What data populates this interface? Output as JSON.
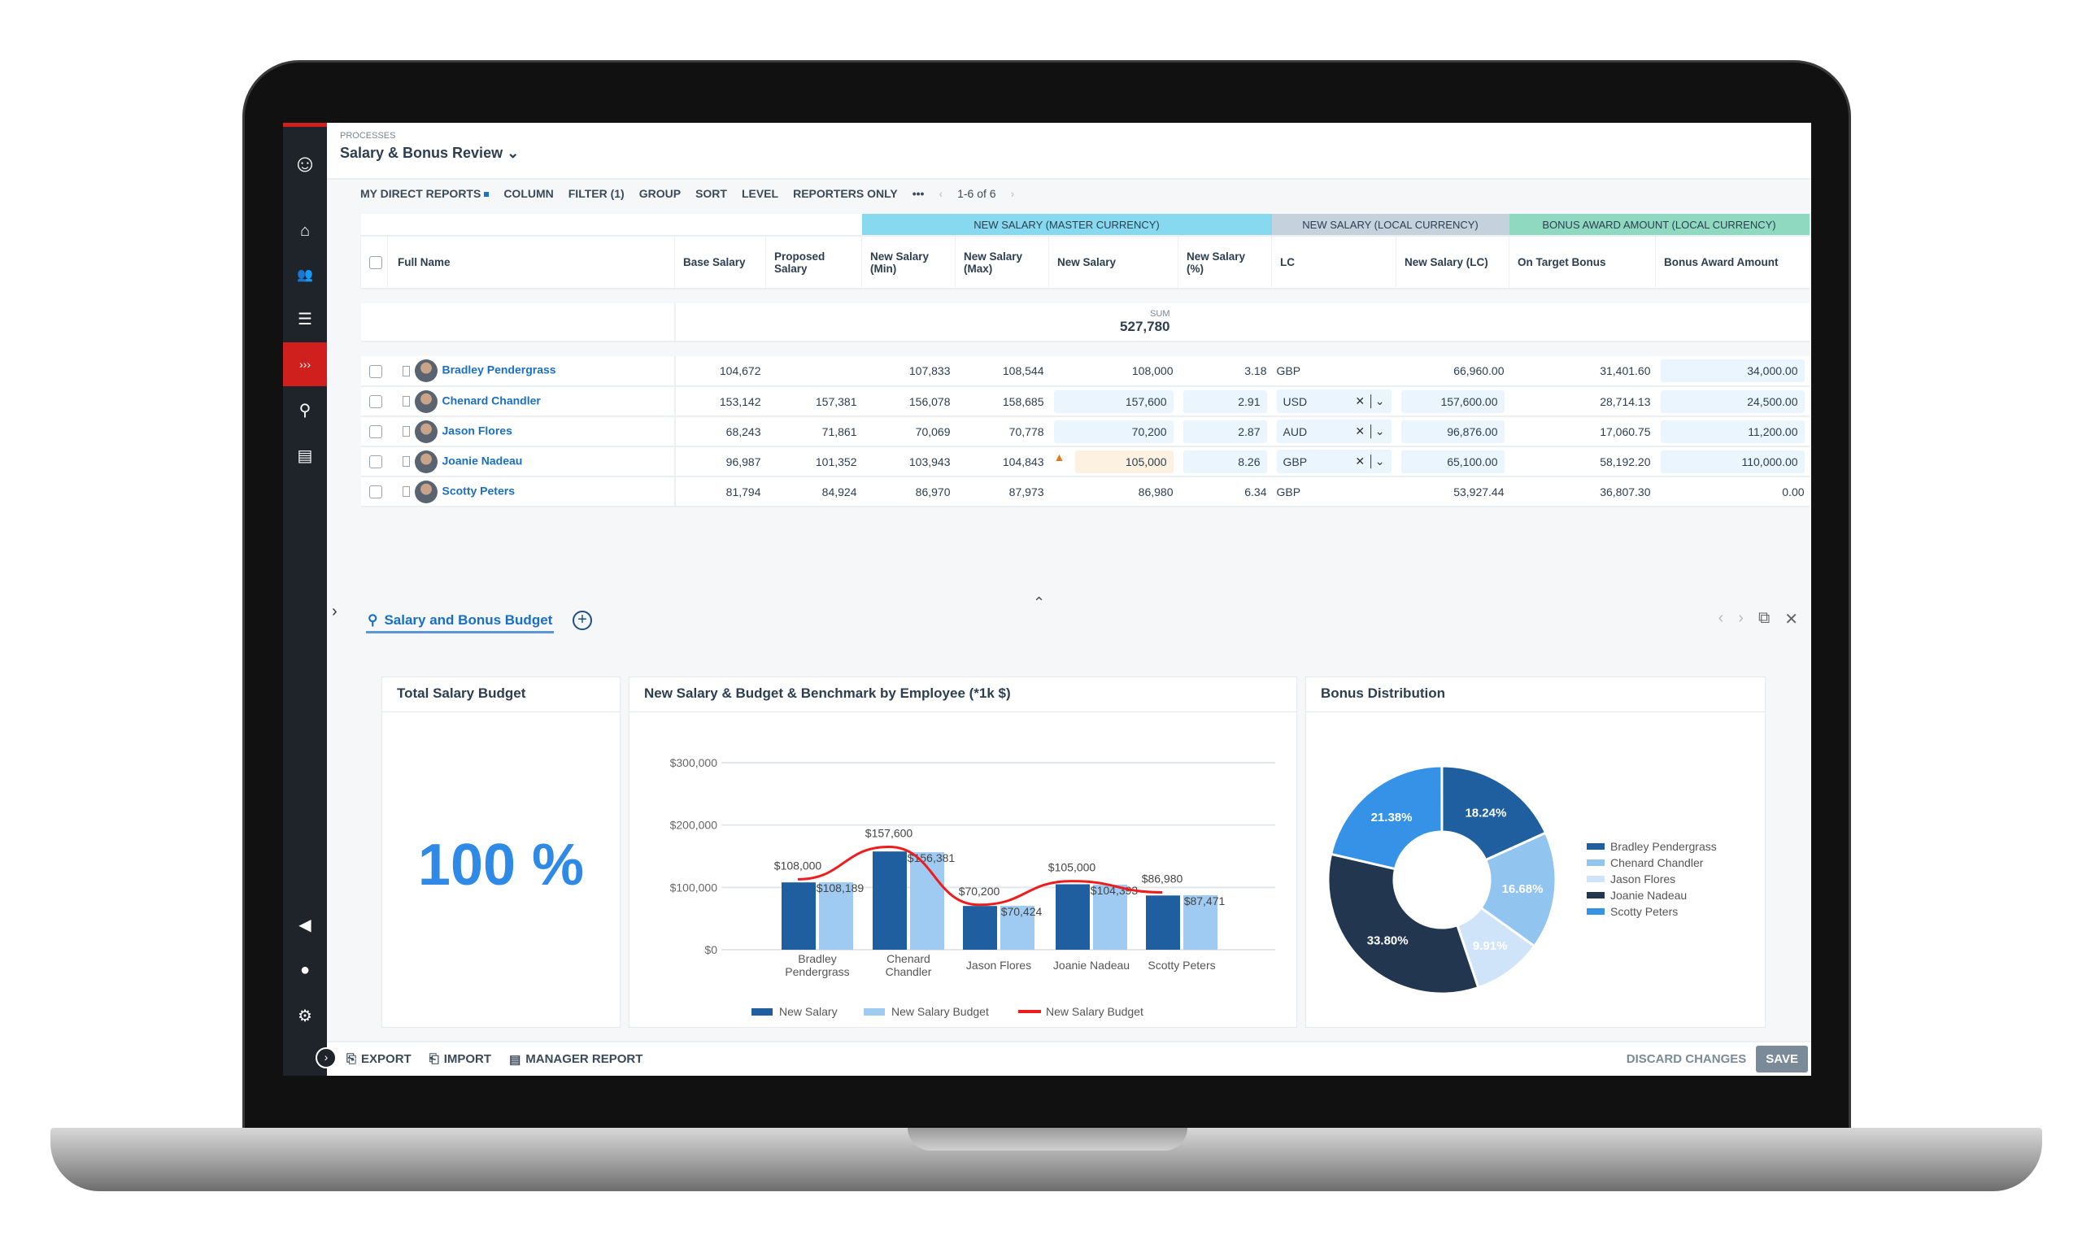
{
  "header": {
    "breadcrumb": "PROCESSES",
    "title": "Salary & Bonus Review"
  },
  "toolbar": {
    "items": [
      "MY DIRECT REPORTS",
      "COLUMN",
      "FILTER (1)",
      "GROUP",
      "SORT",
      "LEVEL",
      "REPORTERS ONLY"
    ],
    "more": "•••",
    "pagination": "1-6 of 6"
  },
  "table": {
    "groups": [
      {
        "label": "NEW SALARY (MASTER CURRENCY)",
        "color": "#86d9ef"
      },
      {
        "label": "NEW SALARY (LOCAL CURRENCY)",
        "color": "#c5d1dc"
      },
      {
        "label": "BONUS AWARD AMOUNT (LOCAL CURRENCY)",
        "color": "#8ed9c0"
      }
    ],
    "columns": [
      "Full Name",
      "Base Salary",
      "Proposed Salary",
      "New Salary (Min)",
      "New Salary (Max)",
      "New Salary",
      "New Salary (%)",
      "LC",
      "New Salary (LC)",
      "On Target Bonus",
      "Bonus Award Amount"
    ],
    "sum_label": "SUM",
    "sum_value": "527,780",
    "rows": [
      {
        "name": "Bradley Pendergrass",
        "base": "104,672",
        "proposed": "",
        "min": "107,833",
        "max": "108,544",
        "new": "108,000",
        "pct": "3.18",
        "lc": "GBP",
        "new_lc": "66,960.00",
        "target": "31,401.60",
        "bonus": "34,000.00",
        "editable": false,
        "warning": false
      },
      {
        "name": "Chenard Chandler",
        "base": "153,142",
        "proposed": "157,381",
        "min": "156,078",
        "max": "158,685",
        "new": "157,600",
        "pct": "2.91",
        "lc": "USD",
        "new_lc": "157,600.00",
        "target": "28,714.13",
        "bonus": "24,500.00",
        "editable": true,
        "warning": false
      },
      {
        "name": "Jason Flores",
        "base": "68,243",
        "proposed": "71,861",
        "min": "70,069",
        "max": "70,778",
        "new": "70,200",
        "pct": "2.87",
        "lc": "AUD",
        "new_lc": "96,876.00",
        "target": "17,060.75",
        "bonus": "11,200.00",
        "editable": true,
        "warning": false
      },
      {
        "name": "Joanie Nadeau",
        "base": "96,987",
        "proposed": "101,352",
        "min": "103,943",
        "max": "104,843",
        "new": "105,000",
        "pct": "8.26",
        "lc": "GBP",
        "new_lc": "65,100.00",
        "target": "58,192.20",
        "bonus": "110,000.00",
        "editable": true,
        "warning": true
      },
      {
        "name": "Scotty Peters",
        "base": "81,794",
        "proposed": "84,924",
        "min": "86,970",
        "max": "87,973",
        "new": "86,980",
        "pct": "6.34",
        "lc": "GBP",
        "new_lc": "53,927.44",
        "target": "36,807.30",
        "bonus": "0.00",
        "editable": false,
        "warning": false
      }
    ]
  },
  "panel": {
    "tab": "Salary and Bonus Budget",
    "cards": {
      "budget_title": "Total Salary Budget",
      "budget_value": "100 %",
      "bar_title": "New Salary & Budget & Benchmark by Employee (*1k $)",
      "pie_title": "Bonus Distribution"
    }
  },
  "footer": {
    "export": "EXPORT",
    "import": "IMPORT",
    "manager_report": "MANAGER REPORT",
    "discard": "DISCARD CHANGES",
    "save": "SAVE"
  },
  "chart_data": [
    {
      "type": "bar",
      "categories": [
        "Bradley Pendergrass",
        "Chenard Chandler",
        "Jason Flores",
        "Joanie Nadeau",
        "Scotty Peters"
      ],
      "yticks": [
        "$0",
        "$100,000",
        "$200,000",
        "$300,000"
      ],
      "ylim": [
        0,
        300000
      ],
      "grid": true,
      "legend": "bottom",
      "series": [
        {
          "name": "New Salary",
          "kind": "bar",
          "color": "#1f5f9f",
          "values": [
            108000,
            157600,
            70200,
            105000,
            86980
          ],
          "labels": [
            "$108,000",
            "$157,600",
            "$70,200",
            "$105,000",
            "$86,980"
          ]
        },
        {
          "name": "New Salary Budget",
          "kind": "bar",
          "color": "#9fcbf2",
          "values": [
            108189,
            156381,
            70424,
            104393,
            87471
          ],
          "labels": [
            "$108,189",
            "$156,381",
            "$70,424",
            "$104,393",
            "$87,471"
          ]
        },
        {
          "name": "New Salary Budget",
          "kind": "line",
          "color": "#ee1c1c",
          "values": [
            113000,
            165000,
            72000,
            110000,
            92000
          ]
        }
      ]
    },
    {
      "type": "pie",
      "donut": true,
      "legend": "right",
      "slices": [
        {
          "name": "Bradley Pendergrass",
          "value": 18.24,
          "label": "18.24%",
          "color": "#1f5f9f"
        },
        {
          "name": "Chenard Chandler",
          "value": 16.68,
          "label": "16.68%",
          "color": "#92c4f0"
        },
        {
          "name": "Jason Flores",
          "value": 9.91,
          "label": "9.91%",
          "color": "#cfe4f8"
        },
        {
          "name": "Joanie Nadeau",
          "value": 33.8,
          "label": "33.80%",
          "color": "#23364f"
        },
        {
          "name": "Scotty Peters",
          "value": 21.38,
          "label": "21.38%",
          "color": "#3592e6"
        }
      ]
    }
  ]
}
